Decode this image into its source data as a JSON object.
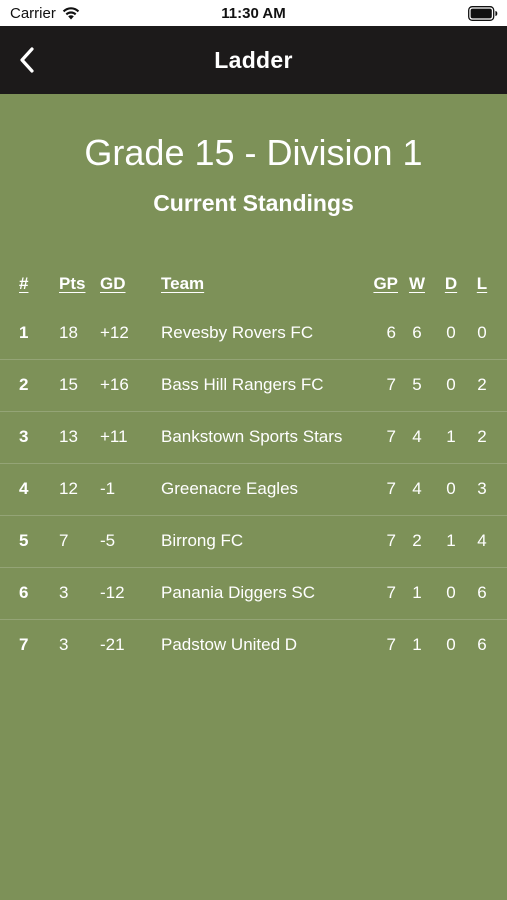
{
  "status_bar": {
    "carrier": "Carrier",
    "time": "11:30 AM"
  },
  "nav": {
    "title": "Ladder",
    "back_icon": "chevron-left-icon"
  },
  "page": {
    "heading": "Grade 15 - Division 1",
    "subheading": "Current Standings"
  },
  "table": {
    "columns": {
      "pos": "#",
      "pts": "Pts",
      "gd": "GD",
      "team": "Team",
      "gp": "GP",
      "w": "W",
      "d": "D",
      "l": "L"
    },
    "rows": [
      {
        "pos": "1",
        "pts": "18",
        "gd": "+12",
        "team": "Revesby Rovers FC",
        "gp": "6",
        "w": "6",
        "d": "0",
        "l": "0"
      },
      {
        "pos": "2",
        "pts": "15",
        "gd": "+16",
        "team": "Bass Hill Rangers FC",
        "gp": "7",
        "w": "5",
        "d": "0",
        "l": "2"
      },
      {
        "pos": "3",
        "pts": "13",
        "gd": "+11",
        "team": "Bankstown Sports Stars",
        "gp": "7",
        "w": "4",
        "d": "1",
        "l": "2"
      },
      {
        "pos": "4",
        "pts": "12",
        "gd": "-1",
        "team": "Greenacre Eagles",
        "gp": "7",
        "w": "4",
        "d": "0",
        "l": "3"
      },
      {
        "pos": "5",
        "pts": "7",
        "gd": "-5",
        "team": "Birrong FC",
        "gp": "7",
        "w": "2",
        "d": "1",
        "l": "4"
      },
      {
        "pos": "6",
        "pts": "3",
        "gd": "-12",
        "team": "Panania Diggers SC",
        "gp": "7",
        "w": "1",
        "d": "0",
        "l": "6"
      },
      {
        "pos": "7",
        "pts": "3",
        "gd": "-21",
        "team": "Padstow United D",
        "gp": "7",
        "w": "1",
        "d": "0",
        "l": "6"
      }
    ]
  },
  "colors": {
    "background": "#7d9158",
    "nav_bar": "#1c1a1a",
    "text": "#ffffff"
  }
}
